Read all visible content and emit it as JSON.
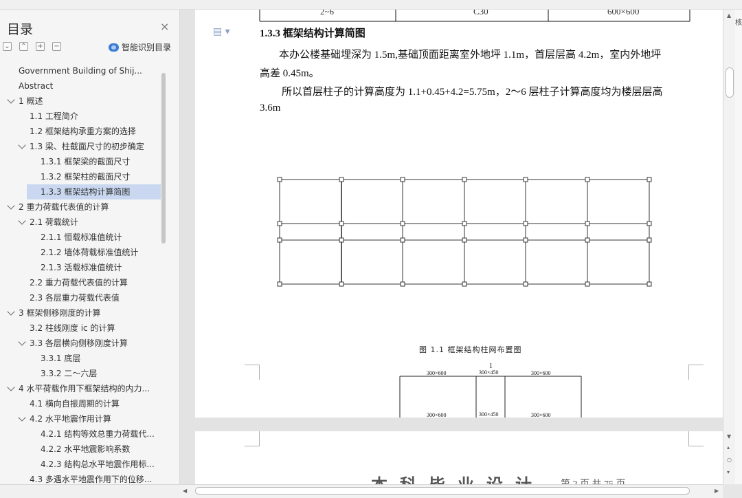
{
  "nav": {
    "title": "目录",
    "close": "×",
    "smart_toc": "智能识别目录",
    "items": [
      {
        "label": "Government Building of Shij...",
        "level": 0,
        "chev": ""
      },
      {
        "label": "Abstract",
        "level": 0,
        "chev": ""
      },
      {
        "label": "1 概述",
        "level": 0,
        "chev": "down"
      },
      {
        "label": "1.1 工程简介",
        "level": 1,
        "chev": ""
      },
      {
        "label": "1.2 框架结构承重方案的选择",
        "level": 1,
        "chev": ""
      },
      {
        "label": "1.3 梁、柱截面尺寸的初步确定",
        "level": 1,
        "chev": "down"
      },
      {
        "label": "1.3.1 框架梁的截面尺寸",
        "level": 2,
        "chev": ""
      },
      {
        "label": "1.3.2 框架柱的截面尺寸",
        "level": 2,
        "chev": ""
      },
      {
        "label": "1.3.3 框架结构计算简图",
        "level": 2,
        "chev": "",
        "selected": true
      },
      {
        "label": "2 重力荷载代表值的计算",
        "level": 0,
        "chev": "down"
      },
      {
        "label": "2.1 荷载统计",
        "level": 1,
        "chev": "down"
      },
      {
        "label": "2.1.1 恒载标准值统计",
        "level": 2,
        "chev": ""
      },
      {
        "label": "2.1.2 墙体荷载标准值统计",
        "level": 2,
        "chev": ""
      },
      {
        "label": "2.1.3 活载标准值统计",
        "level": 2,
        "chev": ""
      },
      {
        "label": "2.2 重力荷载代表值的计算",
        "level": 1,
        "chev": ""
      },
      {
        "label": "2.3 各层重力荷载代表值",
        "level": 1,
        "chev": ""
      },
      {
        "label": "3 框架侧移刚度的计算",
        "level": 0,
        "chev": "down"
      },
      {
        "label": "3.2 柱线刚度 ic 的计算",
        "level": 1,
        "chev": ""
      },
      {
        "label": "3.3 各层横向侧移刚度计算",
        "level": 1,
        "chev": "down"
      },
      {
        "label": "3.3.1 底层",
        "level": 2,
        "chev": ""
      },
      {
        "label": "3.3.2 二～六层",
        "level": 2,
        "chev": ""
      },
      {
        "label": "4 水平荷载作用下框架结构的内力...",
        "level": 0,
        "chev": "down"
      },
      {
        "label": "4.1 横向自振周期的计算",
        "level": 1,
        "chev": ""
      },
      {
        "label": "4.2 水平地震作用计算",
        "level": 1,
        "chev": "down"
      },
      {
        "label": "4.2.1 结构等效总重力荷载代...",
        "level": 2,
        "chev": ""
      },
      {
        "label": "4.2.2 水平地震影响系数",
        "level": 2,
        "chev": ""
      },
      {
        "label": "4.2.3 结构总水平地震作用标...",
        "level": 2,
        "chev": ""
      },
      {
        "label": "4.3 多遇水平地震作用下的位移...",
        "level": 1,
        "chev": ""
      }
    ]
  },
  "document": {
    "table_row": [
      "2~6",
      "C30",
      "600×600"
    ],
    "heading": "1.3.3 框架结构计算简图",
    "para1_line1": "本办公楼基础埋深为 1.5m,基础顶面距离室外地坪 1.1m，首层层高 4.2m，室内外地坪",
    "para1_line2": "高差 0.45m。",
    "para2_line1": "所以首层柱子的计算高度为 1.1+0.45+4.2=5.75m，2～6 层柱子计算高度均为楼层层高",
    "para2_line2": "3.6m",
    "figure_caption": "图 1.1 框架结构柱网布置图",
    "frame_label": "1",
    "beam_labels_top": [
      "300×600",
      "300×450",
      "300×600"
    ],
    "beam_labels_bottom": [
      "300×600",
      "300×450",
      "300×600"
    ],
    "page2_footer_title": "本 科 毕 业 设 计",
    "page2_page_info": "第 2 页 共 75 页"
  },
  "right_rail": {
    "label": "核"
  }
}
